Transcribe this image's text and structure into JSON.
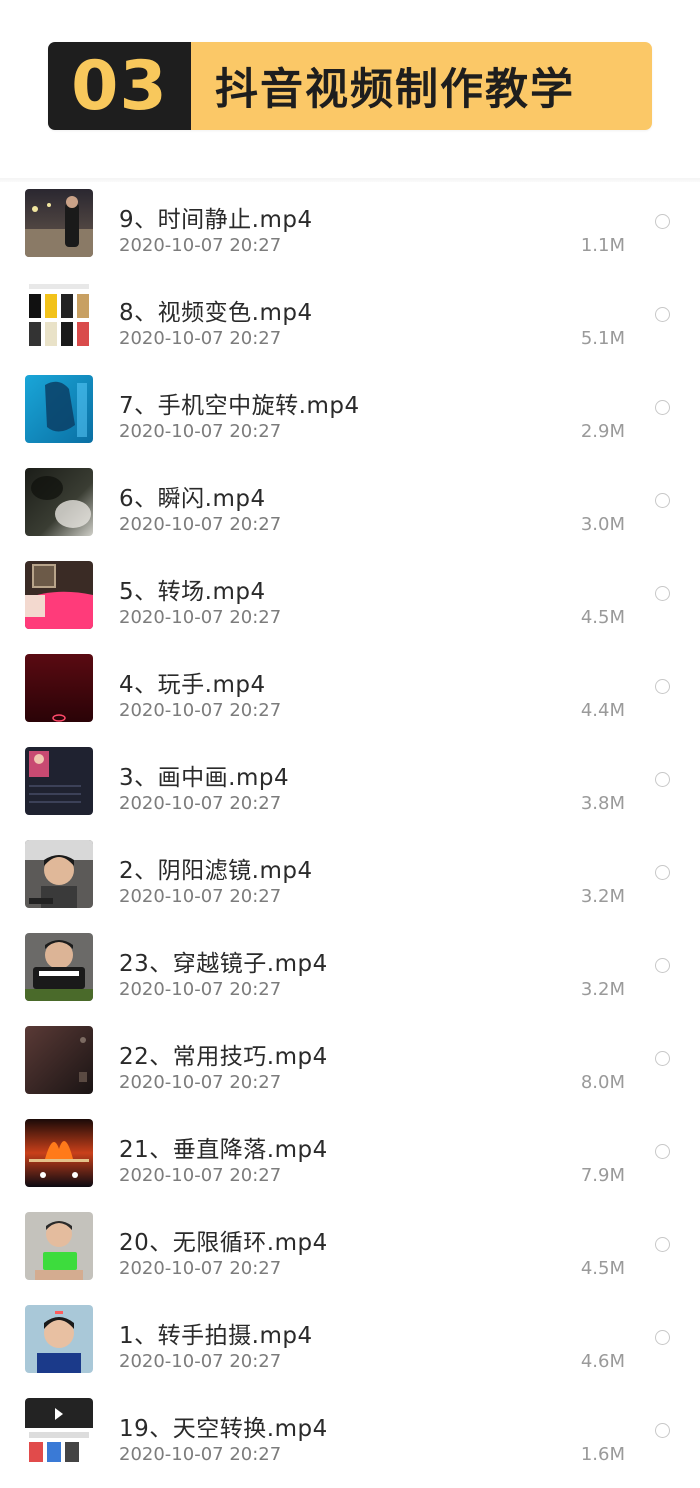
{
  "header": {
    "number": "03",
    "title": "抖音视频制作教学"
  },
  "colors": {
    "banner_dark": "#1e1e1e",
    "banner_yellow": "#fbc867"
  },
  "files": [
    {
      "name": "9、时间静止.mp4",
      "date": "2020-10-07 20:27",
      "size": "1.1M",
      "thumb": "street-night-thumbnail"
    },
    {
      "name": "8、视频变色.mp4",
      "date": "2020-10-07 20:27",
      "size": "5.1M",
      "thumb": "collage-thumbnail"
    },
    {
      "name": "7、手机空中旋转.mp4",
      "date": "2020-10-07 20:27",
      "size": "2.9M",
      "thumb": "blue-screen-thumbnail"
    },
    {
      "name": "6、瞬闪.mp4",
      "date": "2020-10-07 20:27",
      "size": "3.0M",
      "thumb": "blurry-dark-thumbnail"
    },
    {
      "name": "5、转场.mp4",
      "date": "2020-10-07 20:27",
      "size": "4.5M",
      "thumb": "pink-wall-thumbnail"
    },
    {
      "name": "4、玩手.mp4",
      "date": "2020-10-07 20:27",
      "size": "4.4M",
      "thumb": "dark-red-thumbnail"
    },
    {
      "name": "3、画中画.mp4",
      "date": "2020-10-07 20:27",
      "size": "3.8M",
      "thumb": "app-screen-thumbnail"
    },
    {
      "name": "2、阴阳滤镜.mp4",
      "date": "2020-10-07 20:27",
      "size": "3.2M",
      "thumb": "face-filter-thumbnail"
    },
    {
      "name": "23、穿越镜子.mp4",
      "date": "2020-10-07 20:27",
      "size": "3.2M",
      "thumb": "mirror-face-thumbnail"
    },
    {
      "name": "22、常用技巧.mp4",
      "date": "2020-10-07 20:27",
      "size": "8.0M",
      "thumb": "dark-room-thumbnail"
    },
    {
      "name": "21、垂直降落.mp4",
      "date": "2020-10-07 20:27",
      "size": "7.9M",
      "thumb": "fire-thumbnail"
    },
    {
      "name": "20、无限循环.mp4",
      "date": "2020-10-07 20:27",
      "size": "4.5M",
      "thumb": "phone-loop-thumbnail"
    },
    {
      "name": "1、转手拍摄.mp4",
      "date": "2020-10-07 20:27",
      "size": "4.6M",
      "thumb": "selfie-thumbnail"
    },
    {
      "name": "19、天空转换.mp4",
      "date": "2020-10-07 20:27",
      "size": "1.6M",
      "thumb": "sky-editor-thumbnail"
    }
  ]
}
